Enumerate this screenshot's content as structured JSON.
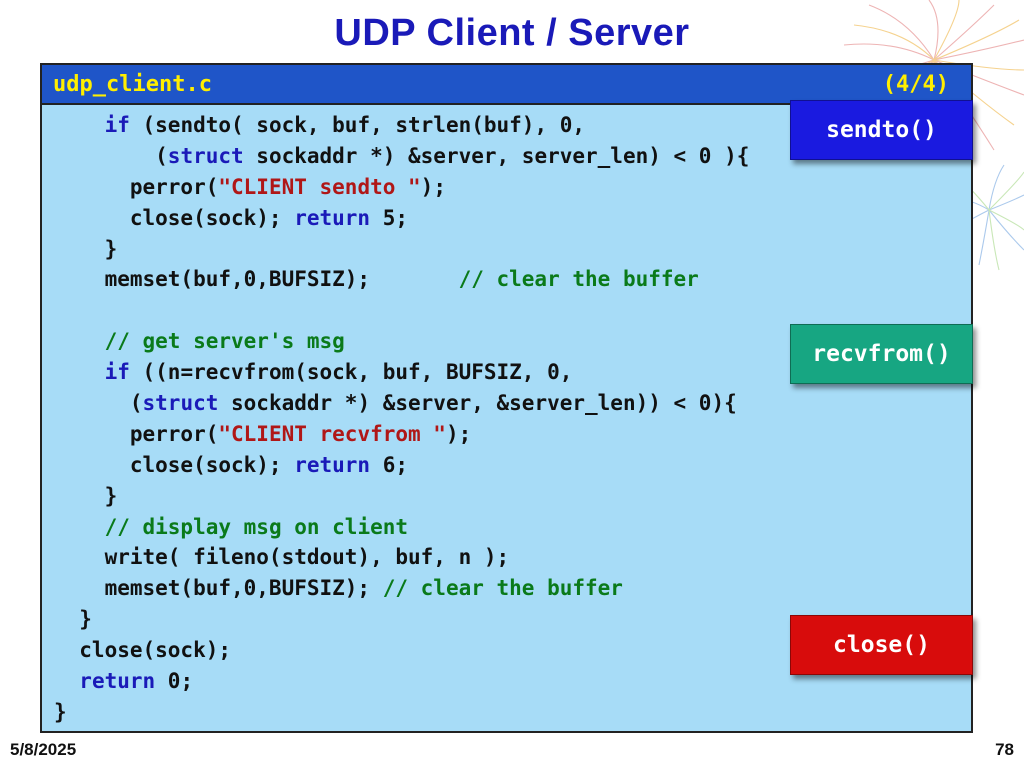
{
  "slide": {
    "title": "UDP Client / Server",
    "footer_date": "5/8/2025",
    "page_number": "78"
  },
  "code_box": {
    "filename": "udp_client.c",
    "part": "(4/4)",
    "lines": [
      [
        {
          "t": "    "
        },
        {
          "t": "if",
          "c": "kw"
        },
        {
          "t": " (sendto( sock, buf, strlen(buf), 0,"
        }
      ],
      [
        {
          "t": "        ("
        },
        {
          "t": "struct",
          "c": "kw"
        },
        {
          "t": " sockaddr *) &server, server_len) < 0 ){"
        }
      ],
      [
        {
          "t": "      perror("
        },
        {
          "t": "\"CLIENT sendto \"",
          "c": "str"
        },
        {
          "t": ");"
        }
      ],
      [
        {
          "t": "      close(sock); "
        },
        {
          "t": "return",
          "c": "kw"
        },
        {
          "t": " 5;"
        }
      ],
      [
        {
          "t": "    }"
        }
      ],
      [
        {
          "t": "    memset(buf,0,BUFSIZ);       "
        },
        {
          "t": "// clear the buffer",
          "c": "cm"
        }
      ],
      [
        {
          "t": ""
        }
      ],
      [
        {
          "t": "    "
        },
        {
          "t": "// get server's msg",
          "c": "cm"
        }
      ],
      [
        {
          "t": "    "
        },
        {
          "t": "if",
          "c": "kw"
        },
        {
          "t": " ((n=recvfrom(sock, buf, BUFSIZ, 0,"
        }
      ],
      [
        {
          "t": "      ("
        },
        {
          "t": "struct",
          "c": "kw"
        },
        {
          "t": " sockaddr *) &server, &server_len)) < 0){"
        }
      ],
      [
        {
          "t": "      perror("
        },
        {
          "t": "\"CLIENT recvfrom \"",
          "c": "str"
        },
        {
          "t": ");"
        }
      ],
      [
        {
          "t": "      close(sock); "
        },
        {
          "t": "return",
          "c": "kw"
        },
        {
          "t": " 6;"
        }
      ],
      [
        {
          "t": "    }"
        }
      ],
      [
        {
          "t": "    "
        },
        {
          "t": "// display msg on client",
          "c": "cm"
        }
      ],
      [
        {
          "t": "    write( fileno(stdout), buf, n );"
        }
      ],
      [
        {
          "t": "    memset(buf,0,BUFSIZ); "
        },
        {
          "t": "// clear the buffer",
          "c": "cm"
        }
      ],
      [
        {
          "t": "  }"
        }
      ],
      [
        {
          "t": "  close(sock);"
        }
      ],
      [
        {
          "t": "  "
        },
        {
          "t": "return",
          "c": "kw"
        },
        {
          "t": " 0;"
        }
      ],
      [
        {
          "t": "}"
        }
      ]
    ]
  },
  "callouts": {
    "sendto": "sendto()",
    "recvfrom": "recvfrom()",
    "close": "close()"
  },
  "colors": {
    "title": "#1a1ab8",
    "header_bg": "#1f55c8",
    "header_text": "#ffee00",
    "code_bg": "#a7dcf7",
    "keyword": "#1a1ab8",
    "string": "#b01717",
    "comment": "#0a7a1a",
    "callout_blue": "#1a1ae0",
    "callout_green": "#17a682",
    "callout_red": "#d80c0c"
  }
}
